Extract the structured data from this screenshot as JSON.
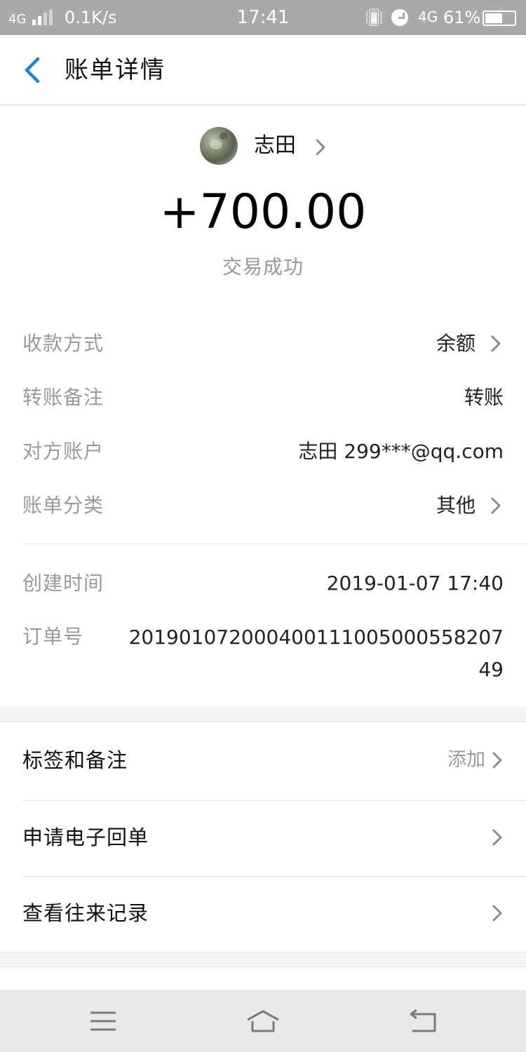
{
  "status_bar": {
    "network": "4G",
    "speed": "0.1K/s",
    "time": "17:41",
    "network2": "4G",
    "battery_percent": "61%",
    "battery_level": 0.61
  },
  "header": {
    "title": "账单详情"
  },
  "summary": {
    "payer_name": "志田",
    "amount": "+700.00",
    "status": "交易成功"
  },
  "details": [
    {
      "label": "收款方式",
      "value": "余额"
    },
    {
      "label": "转账备注",
      "value": "转账"
    },
    {
      "label": "对方账户",
      "value": "志田 299***@qq.com"
    },
    {
      "label": "账单分类",
      "value": "其他"
    }
  ],
  "details2": {
    "created_label": "创建时间",
    "created_value": "2019-01-07 17:40",
    "order_label": "订单号",
    "order_value": "20190107200040011100500055820749"
  },
  "actions": [
    {
      "label": "标签和备注",
      "extra": "添加"
    },
    {
      "label": "申请电子回单"
    },
    {
      "label": "查看往来记录"
    }
  ],
  "colors": {
    "accent": "#1a85d4",
    "status_bar": "#a9a9a9"
  }
}
